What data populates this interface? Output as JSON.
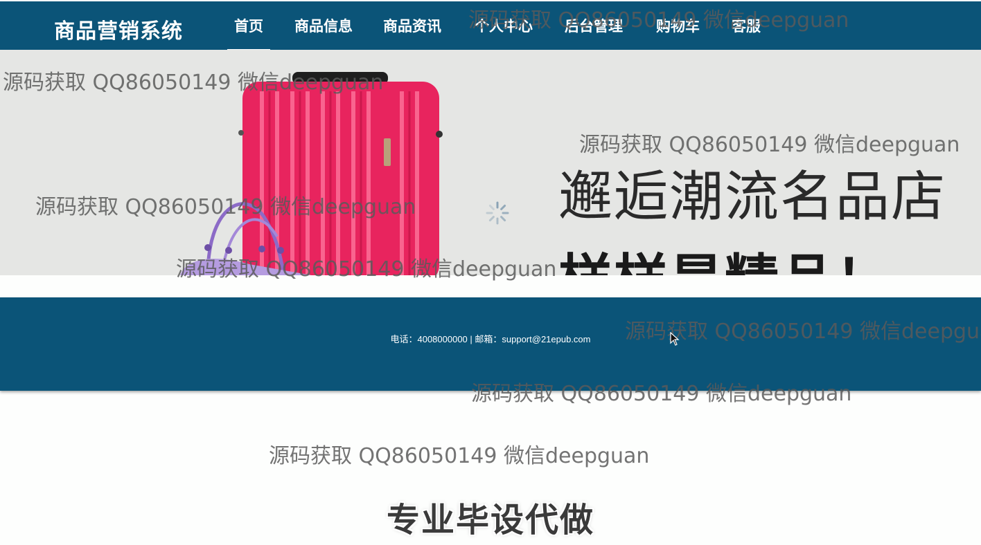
{
  "header": {
    "brand": "商品营销系统",
    "nav": [
      {
        "label": "首页",
        "active": true
      },
      {
        "label": "商品信息",
        "active": false
      },
      {
        "label": "商品资讯",
        "active": false
      },
      {
        "label": "个人中心",
        "active": false
      },
      {
        "label": "后台管理",
        "active": false
      },
      {
        "label": "购物车",
        "active": false
      },
      {
        "label": "客服",
        "active": false
      }
    ]
  },
  "banner": {
    "slogan_line1": "邂逅潮流名品店",
    "slogan_line2": "样样是精品！",
    "image": "pink-suitcase-and-purple-handbag",
    "loading_icon": "spinner-icon"
  },
  "footer": {
    "contact": "电话：4008000000 | 邮箱：support@21epub.com"
  },
  "promo": {
    "text": "专业毕设代做"
  },
  "watermark": {
    "text": "源码获取 QQ86050149 微信deepguan"
  },
  "colors": {
    "header_bg": "#0b5478",
    "footer_bg": "#0b5478",
    "banner_bg": "#e5e6e4",
    "suitcase": "#e8245e"
  }
}
